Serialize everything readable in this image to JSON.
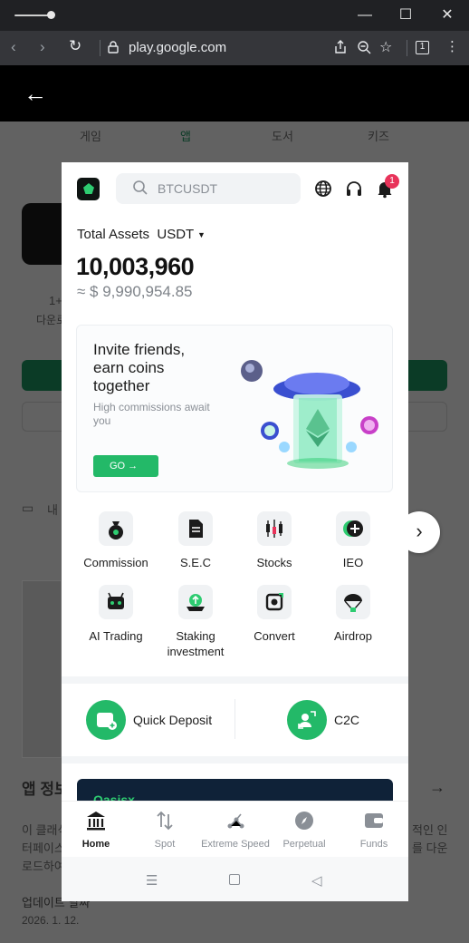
{
  "browser": {
    "url": "play.google.com",
    "tab_count": "1"
  },
  "background_page": {
    "tabs": [
      "게임",
      "앱",
      "도서",
      "키즈"
    ],
    "downloads_short": "1+",
    "downloads_label": "다운로",
    "device_label": "내",
    "section_title": "앱 정보",
    "description_line1": "이 클래식",
    "description_line1_end": "적인 인",
    "description_line2": "터페이스",
    "description_line2_end": "를 다운",
    "description_line3": "로드하여",
    "update_label": "업데이트 날짜",
    "update_date": "2026. 1. 12."
  },
  "app": {
    "search_placeholder": "BTCUSDT",
    "notification_count": "1",
    "total_assets_label": "Total Assets",
    "currency": "USDT",
    "balance": "10,003,960",
    "balance_usd": "≈ $ 9,990,954.85",
    "banner": {
      "title": "Invite friends, earn coins together",
      "subtitle": "High commissions await you",
      "button": "GO →"
    },
    "features": [
      {
        "label": "Commission",
        "icon": "money-bag-icon"
      },
      {
        "label": "S.E.C",
        "icon": "document-icon"
      },
      {
        "label": "Stocks",
        "icon": "candlestick-icon"
      },
      {
        "label": "IEO",
        "icon": "plus-coin-icon"
      },
      {
        "label": "AI Trading",
        "icon": "robot-icon"
      },
      {
        "label": "Staking investment",
        "icon": "staking-icon"
      },
      {
        "label": "Convert",
        "icon": "convert-icon"
      },
      {
        "label": "Airdrop",
        "icon": "parachute-icon"
      }
    ],
    "quick": [
      {
        "label": "Quick Deposit",
        "icon": "wallet-plus-icon"
      },
      {
        "label": "C2C",
        "icon": "people-transfer-icon"
      }
    ],
    "promo_text": "Oasisx",
    "nav": [
      {
        "label": "Home",
        "icon": "bank-icon",
        "active": true
      },
      {
        "label": "Spot",
        "icon": "swap-icon",
        "active": false
      },
      {
        "label": "Extreme Speed",
        "icon": "speed-icon",
        "active": false
      },
      {
        "label": "Perpetual",
        "icon": "compass-icon",
        "active": false
      },
      {
        "label": "Funds",
        "icon": "wallet-icon",
        "active": false
      }
    ]
  },
  "colors": {
    "accent": "#23b968",
    "badge": "#e8335a"
  }
}
